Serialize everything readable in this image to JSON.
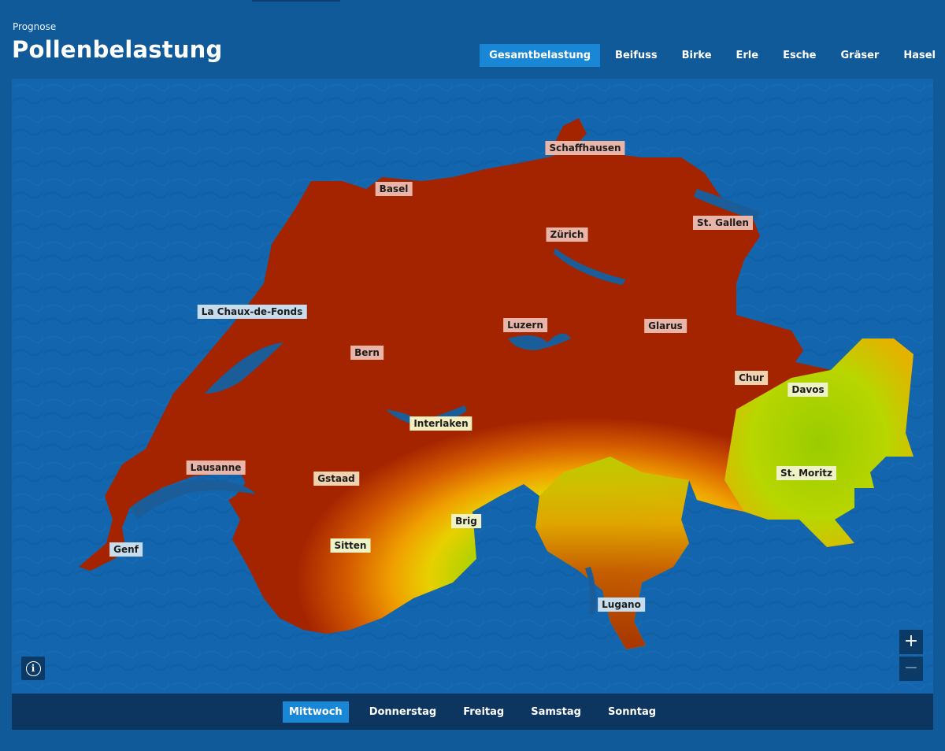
{
  "header": {
    "eyebrow": "Prognose",
    "title": "Pollenbelastung"
  },
  "tabs": [
    {
      "label": "Gesamtbelastung",
      "active": true
    },
    {
      "label": "Beifuss",
      "active": false
    },
    {
      "label": "Birke",
      "active": false
    },
    {
      "label": "Erle",
      "active": false
    },
    {
      "label": "Esche",
      "active": false
    },
    {
      "label": "Gräser",
      "active": false
    },
    {
      "label": "Hasel",
      "active": false
    }
  ],
  "map": {
    "colors": {
      "background": "#1365ad",
      "high": "#a52400",
      "medium_high": "#d45a00",
      "medium": "#f0a000",
      "low": "#a8d200",
      "very_low": "#7fbf00",
      "lake": "#1a5d98"
    },
    "cities": [
      {
        "name": "Schaffhausen",
        "level": "high"
      },
      {
        "name": "Basel",
        "level": "high"
      },
      {
        "name": "Zürich",
        "level": "high"
      },
      {
        "name": "St. Gallen",
        "level": "high"
      },
      {
        "name": "La Chaux-de-Fonds",
        "level": "high"
      },
      {
        "name": "Luzern",
        "level": "high"
      },
      {
        "name": "Glarus",
        "level": "high"
      },
      {
        "name": "Bern",
        "level": "high"
      },
      {
        "name": "Chur",
        "level": "medium"
      },
      {
        "name": "Davos",
        "level": "low"
      },
      {
        "name": "Interlaken",
        "level": "medium"
      },
      {
        "name": "Lausanne",
        "level": "high"
      },
      {
        "name": "Gstaad",
        "level": "medium"
      },
      {
        "name": "St. Moritz",
        "level": "low"
      },
      {
        "name": "Brig",
        "level": "low"
      },
      {
        "name": "Sitten",
        "level": "low"
      },
      {
        "name": "Genf",
        "level": "high"
      },
      {
        "name": "Lugano",
        "level": "medium"
      }
    ],
    "controls": {
      "info_icon": "info-icon",
      "zoom_in_icon": "plus-icon",
      "zoom_out_icon": "minus-icon"
    }
  },
  "days": [
    {
      "label": "Mittwoch",
      "active": true
    },
    {
      "label": "Donnerstag",
      "active": false
    },
    {
      "label": "Freitag",
      "active": false
    },
    {
      "label": "Samstag",
      "active": false
    },
    {
      "label": "Sonntag",
      "active": false
    }
  ]
}
